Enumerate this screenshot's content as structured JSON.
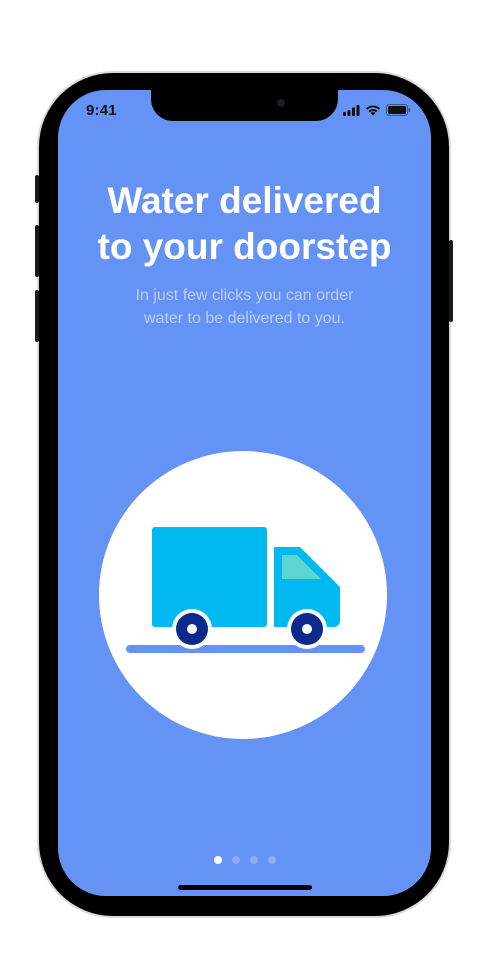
{
  "status_bar": {
    "time": "9:41",
    "icons": [
      "signal-icon",
      "wifi-icon",
      "battery-icon"
    ]
  },
  "onboarding": {
    "title_line1": "Water delivered",
    "title_line2": "to your doorstep",
    "subtitle_line1": "In just few clicks you can order",
    "subtitle_line2": "water to be delivered to you.",
    "illustration": "delivery-truck-icon"
  },
  "pagination": {
    "total": 4,
    "active_index": 0
  },
  "colors": {
    "background": "#6593f5",
    "truck": "#00b9f1",
    "truck_window": "#5bd6d3",
    "wheel": "#0b2a8c",
    "road": "#6593f5"
  }
}
